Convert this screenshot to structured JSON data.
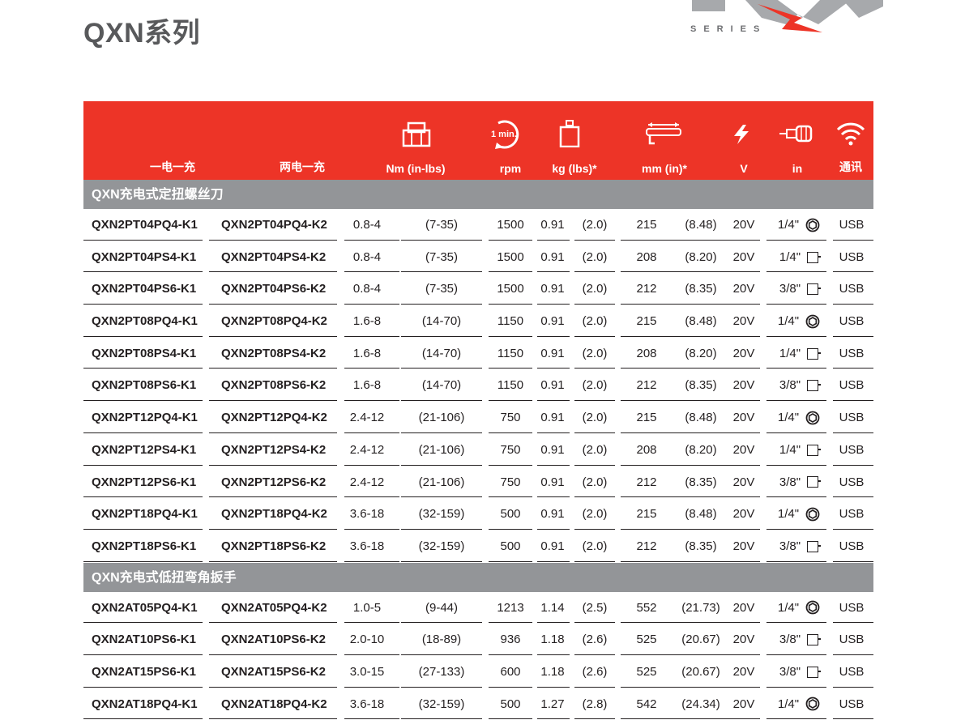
{
  "page": {
    "title": "QXN系列",
    "brand_sub": "SERIES"
  },
  "colors": {
    "header_red": "#ed3427",
    "section_gray": "#939598",
    "title_gray": "#58595b"
  },
  "header": {
    "labels": [
      "一电一充",
      "两电一充",
      "Nm (in-lbs)",
      "rpm",
      "kg (lbs)*",
      "mm (in)*",
      "V",
      "in",
      "通讯"
    ],
    "icons": [
      "torque-nut-icon",
      "rpm-1min-icon",
      "weight-icon",
      "length-tool-icon",
      "voltage-bolt-icon",
      "drive-bit-icon",
      "wifi-icon"
    ],
    "rpm_icon_text": "1 min."
  },
  "sections": [
    {
      "title": "QXN充电式定扭螺丝刀",
      "rows": [
        {
          "k1": "QXN2PT04PQ4-K1",
          "k2": "QXN2PT04PQ4-K2",
          "nm": "0.8-4",
          "inlbs": "(7-35)",
          "rpm": "1500",
          "kg": "0.91",
          "lbs": "(2.0)",
          "mm": "215",
          "inch": "(8.48)",
          "v": "20V",
          "drive": "1/4\"",
          "drive_icon": "hex",
          "comm": "USB"
        },
        {
          "k1": "QXN2PT04PS4-K1",
          "k2": "QXN2PT04PS4-K2",
          "nm": "0.8-4",
          "inlbs": "(7-35)",
          "rpm": "1500",
          "kg": "0.91",
          "lbs": "(2.0)",
          "mm": "208",
          "inch": "(8.20)",
          "v": "20V",
          "drive": "1/4\"",
          "drive_icon": "square",
          "comm": "USB"
        },
        {
          "k1": "QXN2PT04PS6-K1",
          "k2": "QXN2PT04PS6-K2",
          "nm": "0.8-4",
          "inlbs": "(7-35)",
          "rpm": "1500",
          "kg": "0.91",
          "lbs": "(2.0)",
          "mm": "212",
          "inch": "(8.35)",
          "v": "20V",
          "drive": "3/8\"",
          "drive_icon": "square",
          "comm": "USB"
        },
        {
          "k1": "QXN2PT08PQ4-K1",
          "k2": "QXN2PT08PQ4-K2",
          "nm": "1.6-8",
          "inlbs": "(14-70)",
          "rpm": "1150",
          "kg": "0.91",
          "lbs": "(2.0)",
          "mm": "215",
          "inch": "(8.48)",
          "v": "20V",
          "drive": "1/4\"",
          "drive_icon": "hex",
          "comm": "USB"
        },
        {
          "k1": "QXN2PT08PS4-K1",
          "k2": "QXN2PT08PS4-K2",
          "nm": "1.6-8",
          "inlbs": "(14-70)",
          "rpm": "1150",
          "kg": "0.91",
          "lbs": "(2.0)",
          "mm": "208",
          "inch": "(8.20)",
          "v": "20V",
          "drive": "1/4\"",
          "drive_icon": "square",
          "comm": "USB"
        },
        {
          "k1": "QXN2PT08PS6-K1",
          "k2": "QXN2PT08PS6-K2",
          "nm": "1.6-8",
          "inlbs": "(14-70)",
          "rpm": "1150",
          "kg": "0.91",
          "lbs": "(2.0)",
          "mm": "212",
          "inch": "(8.35)",
          "v": "20V",
          "drive": "3/8\"",
          "drive_icon": "square",
          "comm": "USB"
        },
        {
          "k1": "QXN2PT12PQ4-K1",
          "k2": "QXN2PT12PQ4-K2",
          "nm": "2.4-12",
          "inlbs": "(21-106)",
          "rpm": "750",
          "kg": "0.91",
          "lbs": "(2.0)",
          "mm": "215",
          "inch": "(8.48)",
          "v": "20V",
          "drive": "1/4\"",
          "drive_icon": "hex",
          "comm": "USB"
        },
        {
          "k1": "QXN2PT12PS4-K1",
          "k2": "QXN2PT12PS4-K2",
          "nm": "2.4-12",
          "inlbs": "(21-106)",
          "rpm": "750",
          "kg": "0.91",
          "lbs": "(2.0)",
          "mm": "208",
          "inch": "(8.20)",
          "v": "20V",
          "drive": "1/4\"",
          "drive_icon": "square",
          "comm": "USB"
        },
        {
          "k1": "QXN2PT12PS6-K1",
          "k2": "QXN2PT12PS6-K2",
          "nm": "2.4-12",
          "inlbs": "(21-106)",
          "rpm": "750",
          "kg": "0.91",
          "lbs": "(2.0)",
          "mm": "212",
          "inch": "(8.35)",
          "v": "20V",
          "drive": "3/8\"",
          "drive_icon": "square",
          "comm": "USB"
        },
        {
          "k1": "QXN2PT18PQ4-K1",
          "k2": "QXN2PT18PQ4-K2",
          "nm": "3.6-18",
          "inlbs": "(32-159)",
          "rpm": "500",
          "kg": "0.91",
          "lbs": "(2.0)",
          "mm": "215",
          "inch": "(8.48)",
          "v": "20V",
          "drive": "1/4\"",
          "drive_icon": "hex",
          "comm": "USB"
        },
        {
          "k1": "QXN2PT18PS6-K1",
          "k2": "QXN2PT18PS6-K2",
          "nm": "3.6-18",
          "inlbs": "(32-159)",
          "rpm": "500",
          "kg": "0.91",
          "lbs": "(2.0)",
          "mm": "212",
          "inch": "(8.35)",
          "v": "20V",
          "drive": "3/8\"",
          "drive_icon": "square",
          "comm": "USB"
        }
      ]
    },
    {
      "title": "QXN充电式低扭弯角扳手",
      "rows": [
        {
          "k1": "QXN2AT05PQ4-K1",
          "k2": "QXN2AT05PQ4-K2",
          "nm": "1.0-5",
          "inlbs": "(9-44)",
          "rpm": "1213",
          "kg": "1.14",
          "lbs": "(2.5)",
          "mm": "552",
          "inch": "(21.73)",
          "v": "20V",
          "drive": "1/4\"",
          "drive_icon": "hex",
          "comm": "USB"
        },
        {
          "k1": "QXN2AT10PS6-K1",
          "k2": "QXN2AT10PS6-K2",
          "nm": "2.0-10",
          "inlbs": "(18-89)",
          "rpm": "936",
          "kg": "1.18",
          "lbs": "(2.6)",
          "mm": "525",
          "inch": "(20.67)",
          "v": "20V",
          "drive": "3/8\"",
          "drive_icon": "square",
          "comm": "USB"
        },
        {
          "k1": "QXN2AT15PS6-K1",
          "k2": "QXN2AT15PS6-K2",
          "nm": "3.0-15",
          "inlbs": "(27-133)",
          "rpm": "600",
          "kg": "1.18",
          "lbs": "(2.6)",
          "mm": "525",
          "inch": "(20.67)",
          "v": "20V",
          "drive": "3/8\"",
          "drive_icon": "square",
          "comm": "USB"
        },
        {
          "k1": "QXN2AT18PQ4-K1",
          "k2": "QXN2AT18PQ4-K2",
          "nm": "3.6-18",
          "inlbs": "(32-159)",
          "rpm": "500",
          "kg": "1.27",
          "lbs": "(2.8)",
          "mm": "542",
          "inch": "(24.34)",
          "v": "20V",
          "drive": "1/4\"",
          "drive_icon": "hex",
          "comm": "USB"
        }
      ]
    }
  ]
}
